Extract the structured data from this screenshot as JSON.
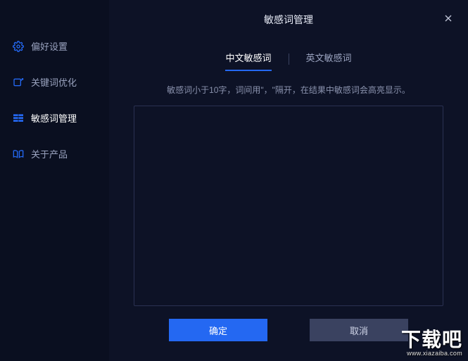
{
  "sidebar": {
    "items": [
      {
        "label": "偏好设置"
      },
      {
        "label": "关键词优化"
      },
      {
        "label": "敏感词管理"
      },
      {
        "label": "关于产品"
      }
    ]
  },
  "header": {
    "title": "敏感词管理"
  },
  "tabs": {
    "items": [
      {
        "label": "中文敏感词"
      },
      {
        "label": "英文敏感词"
      }
    ]
  },
  "hint": "敏感词小于10字，词间用\"，\"隔开，在结果中敏感词会高亮显示。",
  "textarea": {
    "value": ""
  },
  "buttons": {
    "confirm": "确定",
    "cancel": "取消"
  },
  "watermark": {
    "main": "下载吧",
    "sub": "www.xiazaiba.com"
  }
}
